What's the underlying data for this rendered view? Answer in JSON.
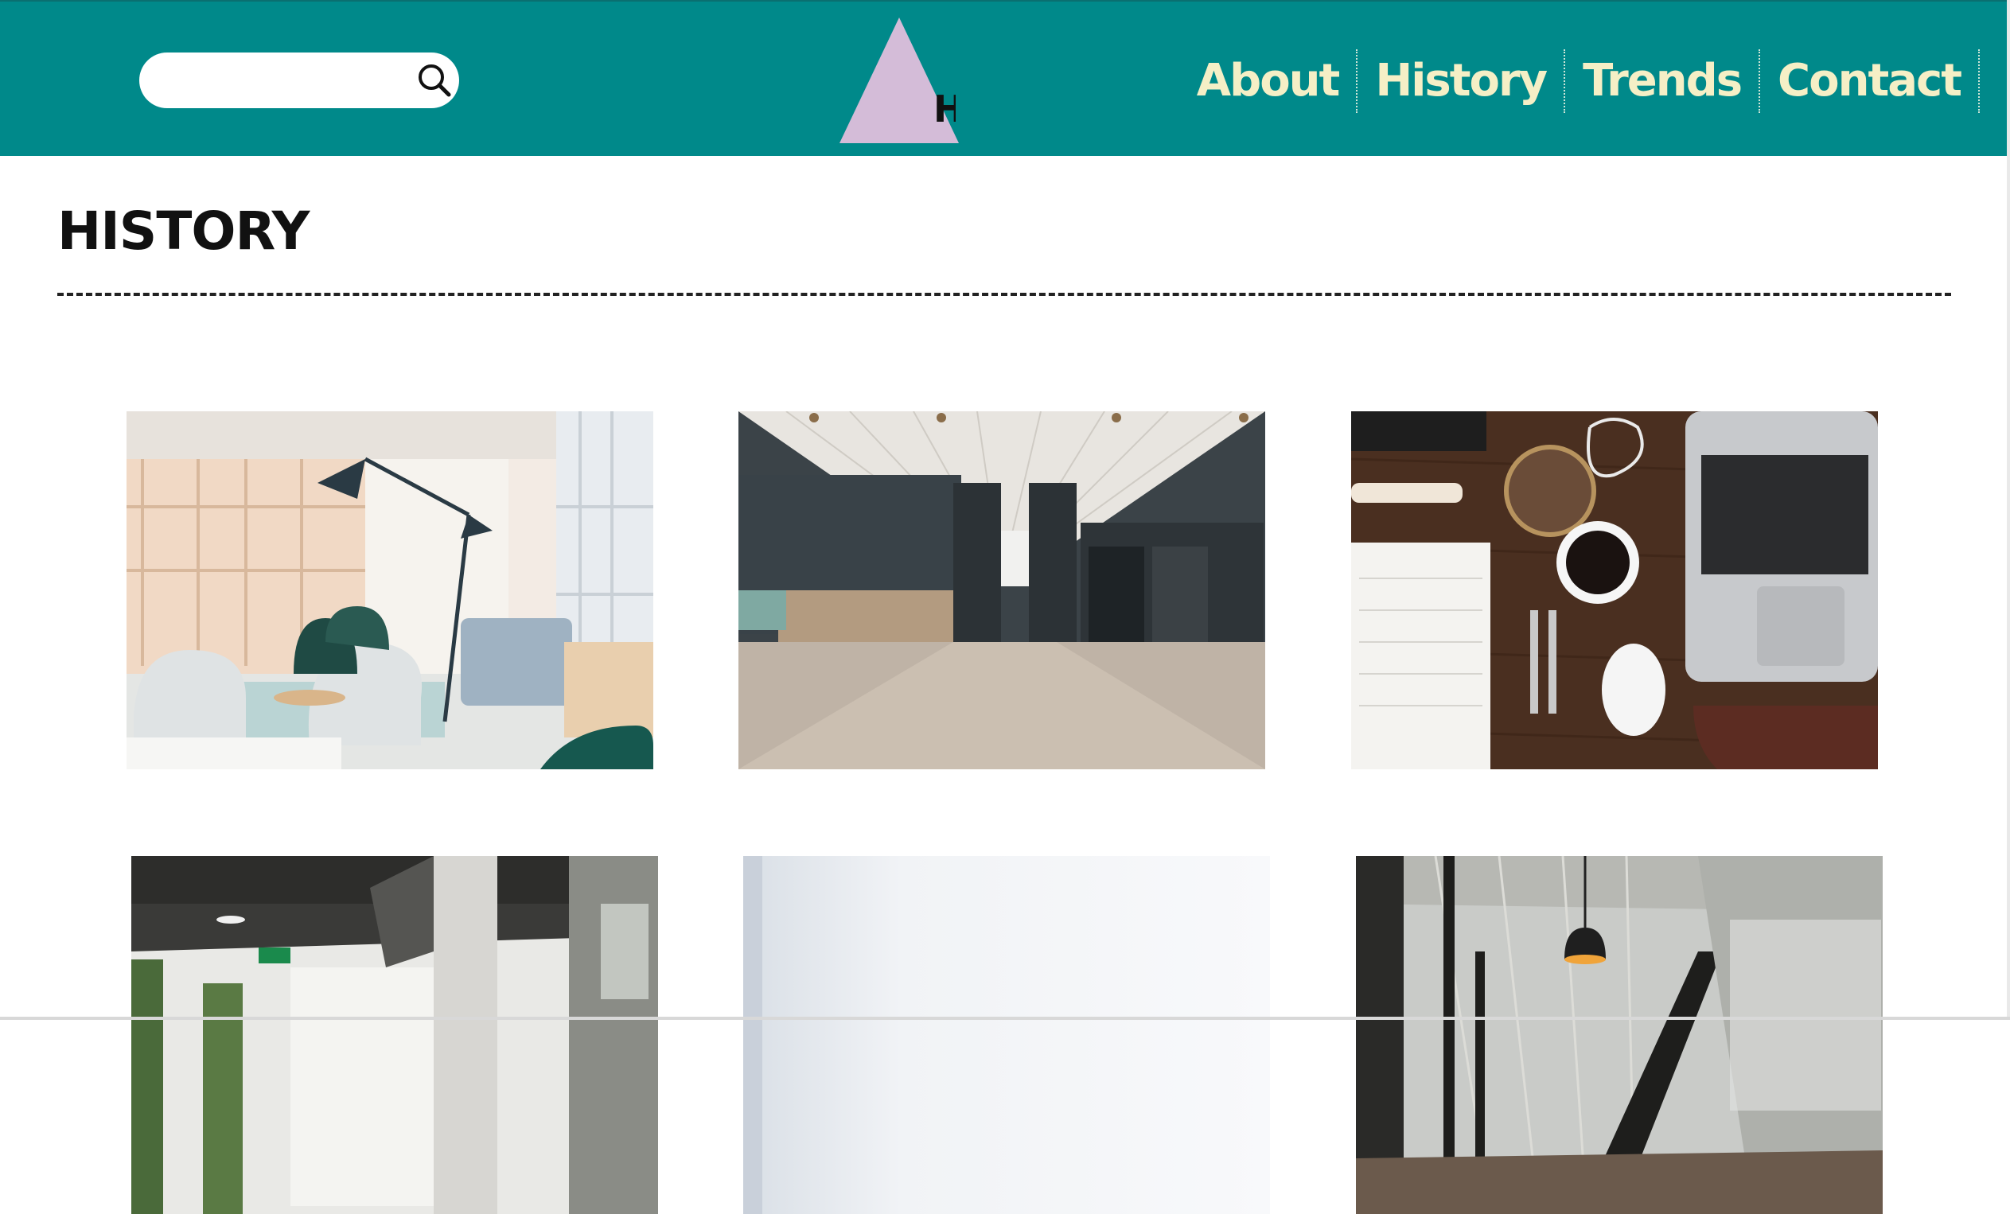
{
  "header": {
    "background": "#00898a",
    "search": {
      "placeholder": "",
      "value": "",
      "icon": "search-icon"
    },
    "logo": {
      "shape": "triangle",
      "color": "#d4bcd8",
      "letter": "H"
    },
    "nav": [
      {
        "label": "About"
      },
      {
        "label": "History"
      },
      {
        "label": "Trends"
      },
      {
        "label": "Contact"
      }
    ],
    "nav_color": "#f5efc6"
  },
  "main": {
    "title": "HISTORY",
    "gallery": [
      {
        "subject": "lounge-with-chairs-and-floor-lamp"
      },
      {
        "subject": "empty-office-corridor"
      },
      {
        "subject": "desk-with-laptop-coffee-and-notebook"
      },
      {
        "subject": "open-office-with-pillars"
      },
      {
        "subject": "bright-white-room"
      },
      {
        "subject": "glass-office-with-pendant-lamp"
      }
    ]
  }
}
